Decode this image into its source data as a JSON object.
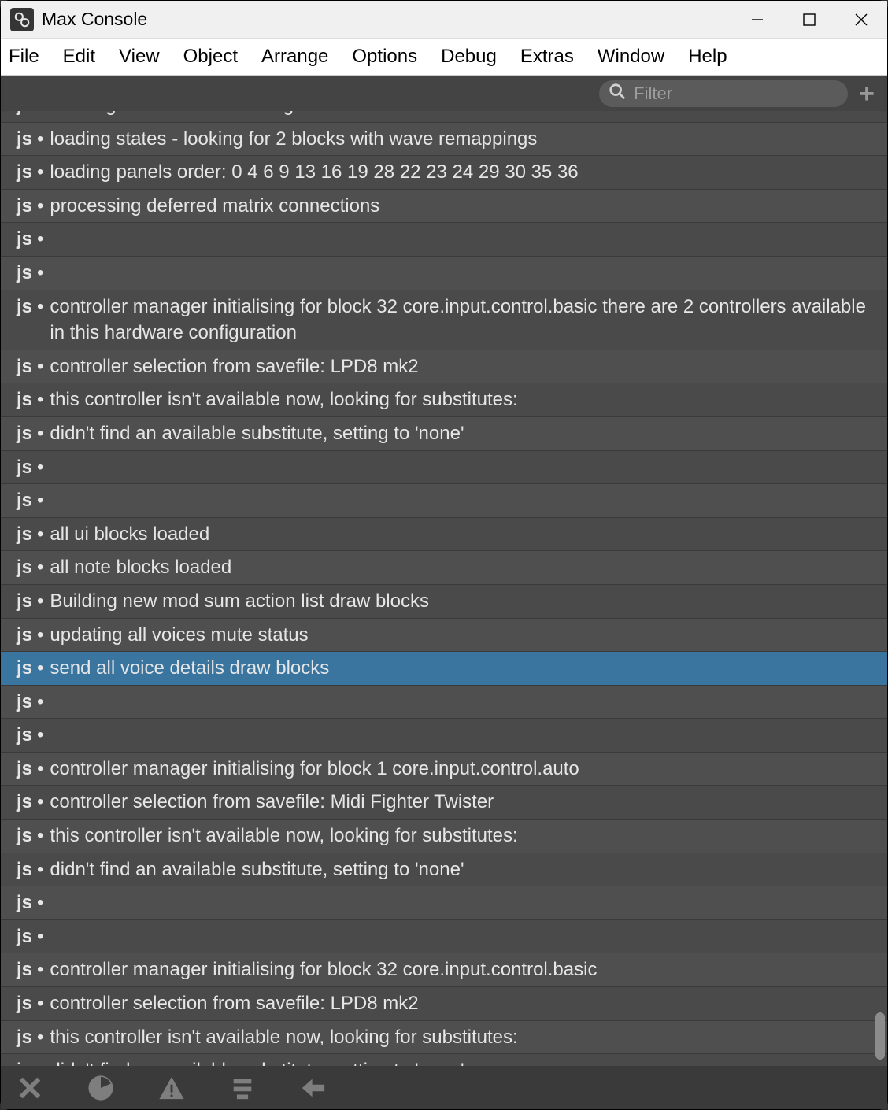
{
  "titlebar": {
    "title": "Max Console"
  },
  "menubar": {
    "items": [
      "File",
      "Edit",
      "View",
      "Object",
      "Arrange",
      "Options",
      "Debug",
      "Extras",
      "Window",
      "Help"
    ]
  },
  "filter": {
    "placeholder": "Filter"
  },
  "console": {
    "source": "js",
    "selected_index": 16,
    "rows": [
      "deleting all states of old song",
      "loading states   - looking for   2  blocks with wave remappings",
      "loading panels order:   0  4  6  9  13  16  19  28  22  23  24  29  30  35  36",
      "processing deferred matrix connections",
      "",
      "",
      "controller manager initialising for block  32  core.input.control.basic  there are  2  controllers available in this hardware configuration",
      "controller selection from savefile:  LPD8 mk2",
      "this controller isn't available now, looking for substitutes:",
      "didn't find an available substitute, setting to 'none'",
      "",
      "",
      "all ui blocks loaded",
      "all note blocks loaded",
      "Building new mod sum action list  draw blocks",
      "updating all voices mute status",
      "send all voice details  draw blocks",
      "",
      "",
      "controller manager initialising for block  1  core.input.control.auto",
      "controller selection from savefile:  Midi Fighter Twister",
      "this controller isn't available now, looking for substitutes:",
      "didn't find an available substitute, setting to 'none'",
      "",
      "",
      "controller manager initialising for block  32  core.input.control.basic",
      "controller selection from savefile:  LPD8 mk2",
      "this controller isn't available now, looking for substitutes:",
      "didn't find an available substitute, setting to 'none'"
    ]
  }
}
